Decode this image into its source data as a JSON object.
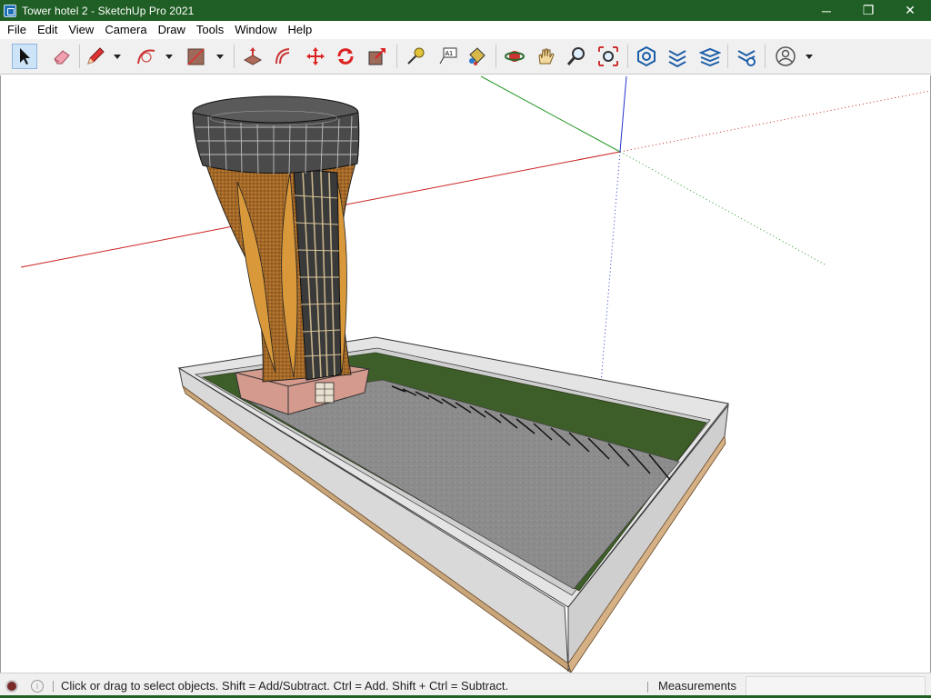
{
  "window": {
    "title": "Tower hotel 2 - SketchUp Pro 2021",
    "controls": {
      "minimize": "─",
      "maximize": "❐",
      "close": "✕"
    }
  },
  "menu": [
    "File",
    "Edit",
    "View",
    "Camera",
    "Draw",
    "Tools",
    "Window",
    "Help"
  ],
  "toolbar": {
    "tools": [
      "select-icon",
      "eraser-icon",
      "pencil-icon",
      "arc-icon",
      "rectangle-icon",
      "push-pull-icon",
      "offset-icon",
      "move-icon",
      "rotate-icon",
      "scale-icon",
      "tape-measure-icon",
      "text-icon",
      "paint-bucket-icon",
      "orbit-icon",
      "pan-icon",
      "zoom-icon",
      "zoom-extents-icon",
      "warehouse-icon",
      "extension-warehouse-icon",
      "layout-icon",
      "extension-manager-icon",
      "account-icon"
    ],
    "text_tool_label": "A1",
    "selected_tool": "select-icon"
  },
  "viewport": {
    "axis_colors": {
      "red": "#cc2222",
      "green": "#2a9a2a",
      "blue": "#2233cc"
    },
    "model_colors": {
      "grass": "#3d5e28",
      "pavement": "#8a8a8a",
      "wall": "#cfcfcf",
      "base": "#c9a57a",
      "tower_shell": "#b0722e",
      "tower_glass": "#3a3a3a",
      "podium": "#d49a8e"
    }
  },
  "status": {
    "hint": "Click or drag to select objects. Shift = Add/Subtract. Ctrl = Add. Shift + Ctrl = Subtract.",
    "measurements_label": "Measurements",
    "measurements_value": ""
  }
}
